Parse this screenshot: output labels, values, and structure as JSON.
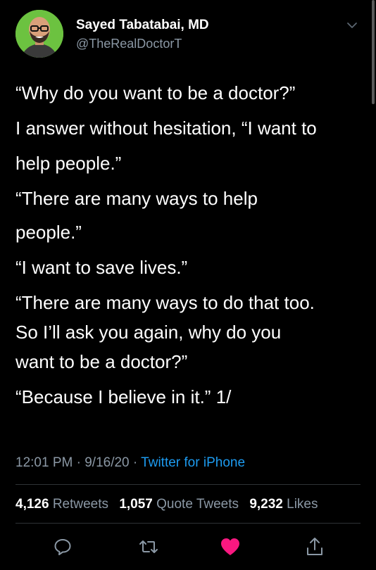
{
  "author": {
    "display_name": "Sayed Tabatabai, MD",
    "handle": "@TheRealDoctorT",
    "avatar_icon": "avatar-portrait"
  },
  "tweet": {
    "lines": [
      "“Why do you want to be a doctor?”",
      "I answer without hesitation, “I want to",
      "help people.”",
      "“There are many ways to help",
      "people.”",
      "“I want to save lives.”",
      "“There are many ways to do that too.",
      "So I’ll ask you again, why do you",
      "want to be a doctor?”",
      "“Because I believe in it.”  1/"
    ]
  },
  "meta": {
    "time": "12:01 PM",
    "separator": "·",
    "date": "9/16/20",
    "source": "Twitter for iPhone"
  },
  "stats": {
    "retweets_count": "4,126",
    "retweets_label": "Retweets",
    "quotes_count": "1,057",
    "quotes_label": "Quote Tweets",
    "likes_count": "9,232",
    "likes_label": "Likes"
  },
  "actions": {
    "reply_icon": "reply-icon",
    "retweet_icon": "retweet-icon",
    "like_icon": "heart-icon",
    "share_icon": "share-icon"
  },
  "colors": {
    "background": "#000000",
    "text": "#ffffff",
    "secondary_text": "#8b98a5",
    "link": "#1d9bf0",
    "like": "#f91880",
    "divider": "#2f3336"
  }
}
